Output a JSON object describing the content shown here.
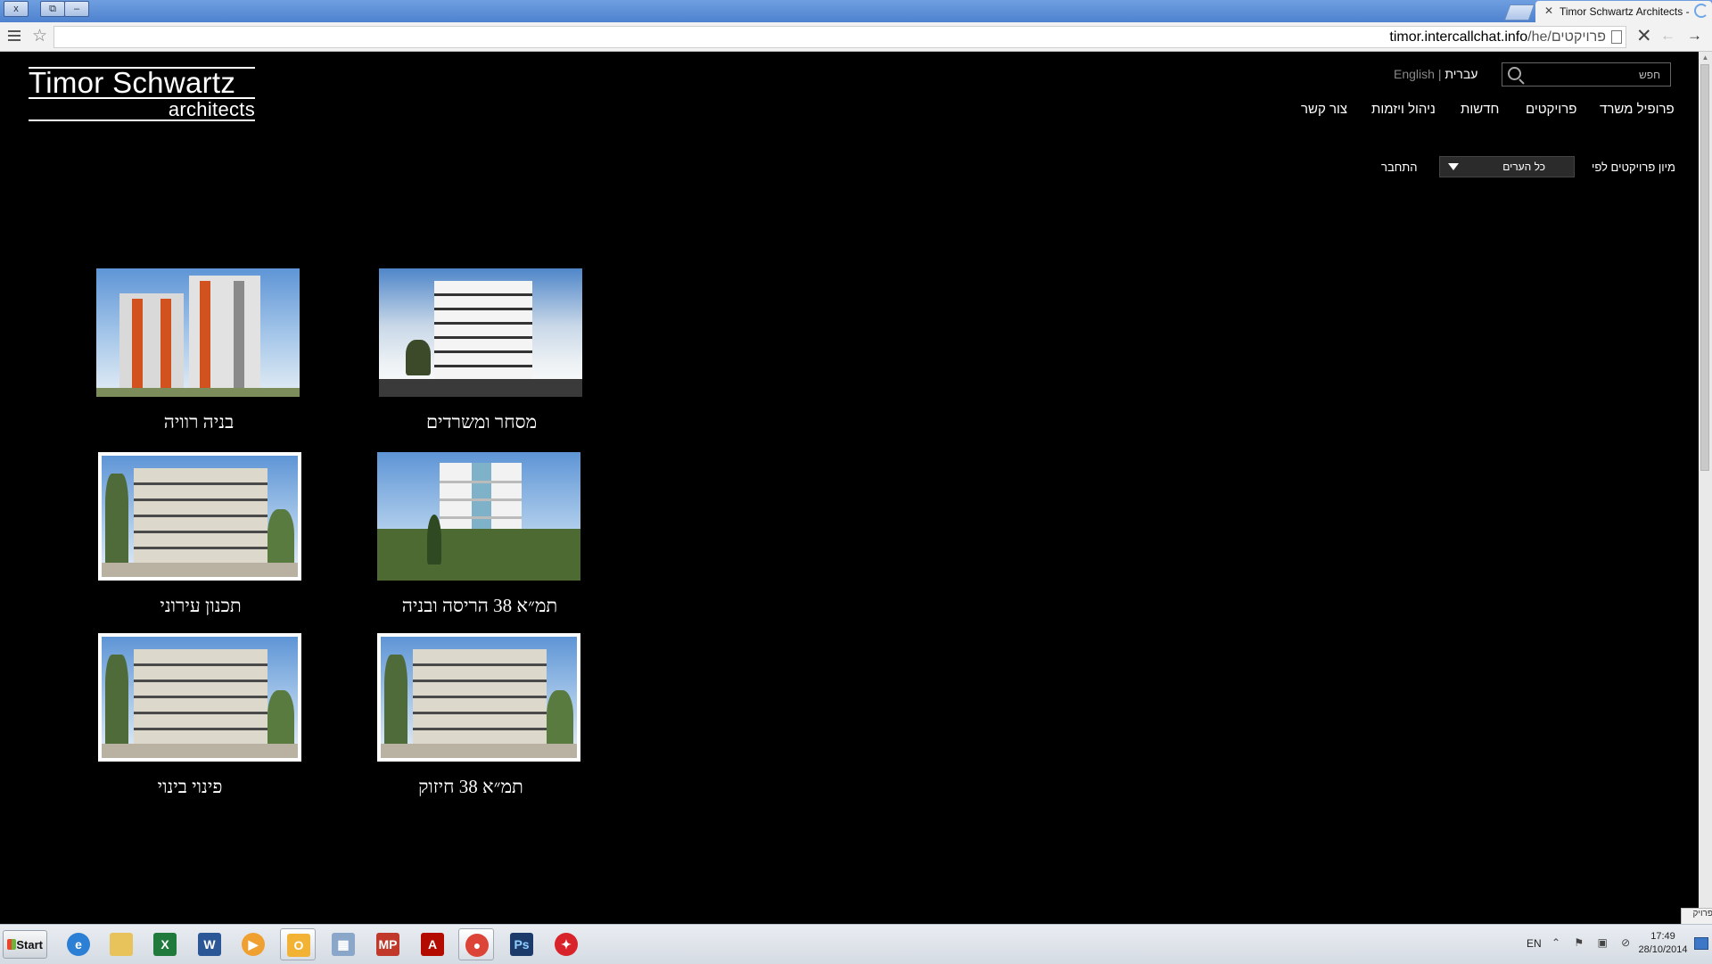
{
  "browser": {
    "tab_title": "Timor Schwartz Architects -",
    "url_host": "timor.intercallchat.info",
    "url_path": "/he/פרויקטים",
    "window_buttons": [
      "x",
      "⧉",
      "–"
    ]
  },
  "logo": {
    "line1": "Timor Schwartz",
    "line2": "architects"
  },
  "language": {
    "english": "English",
    "separator": "|",
    "hebrew": "עברית"
  },
  "search": {
    "placeholder": "חפש"
  },
  "nav": [
    {
      "label": "פרופיל משרד"
    },
    {
      "label": "פרויקטים"
    },
    {
      "label": "חדשות"
    },
    {
      "label": "ניהול ויזמות"
    },
    {
      "label": "צור קשר"
    }
  ],
  "filter": {
    "label": "מיון פרויקטים לפי",
    "selected": "כל הערים",
    "connect": "התחבר"
  },
  "projects": [
    {
      "title": "מסחר ומשרדים"
    },
    {
      "title": "בניה רוויה"
    },
    {
      "title": "תמ״א 38 הריסה ובניה"
    },
    {
      "title": "תכנון עירוני"
    },
    {
      "title": "תמ״א 38 חיזוק"
    },
    {
      "title": "פינוי בינוי"
    }
  ],
  "status_text": "פרויק",
  "taskbar": {
    "start": "Start",
    "apps": [
      "internet-explorer",
      "file-explorer",
      "excel",
      "word",
      "media-player",
      "outlook",
      "calculator",
      "mp",
      "acrobat",
      "chrome",
      "photoshop",
      "app-red"
    ],
    "tray_lang": "EN",
    "time": "17:49",
    "date": "28/10/2014"
  }
}
